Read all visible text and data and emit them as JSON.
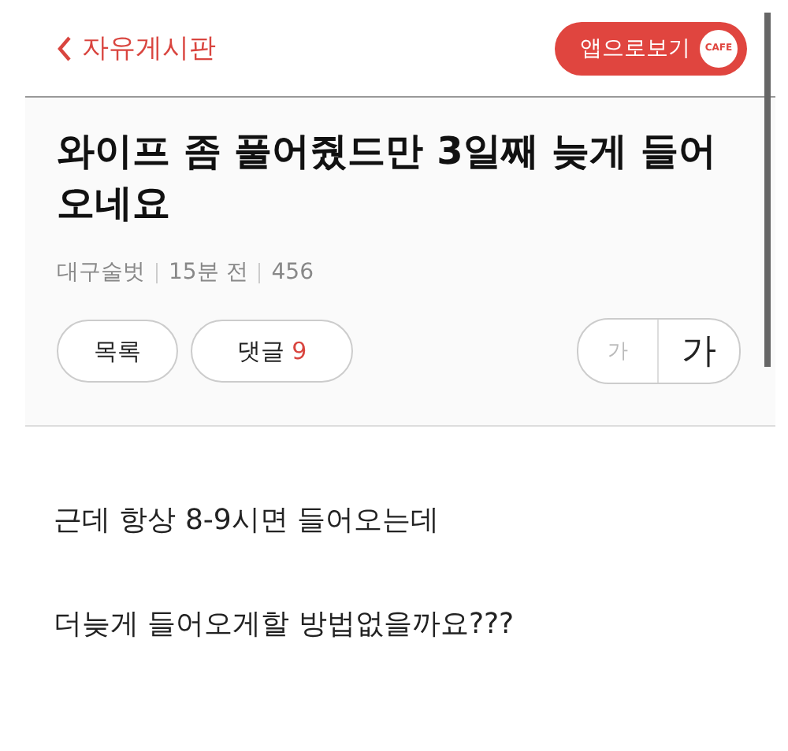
{
  "header": {
    "back_label": "자유게시판",
    "app_button": {
      "label": "앱으로보기",
      "badge": "CAFE"
    }
  },
  "post": {
    "title": "와이프 좀 풀어줬드만 3일째 늦게 들어오네요",
    "author": "대구술벗",
    "time": "15분 전",
    "views": "456"
  },
  "actions": {
    "list_button": "목록",
    "comments_label": "댓글",
    "comments_count": "9",
    "font_small": "가",
    "font_large": "가"
  },
  "body": [
    "근데 항상 8-9시면 들어오는데",
    "더늦게 들어오게할 방법없을까요???"
  ]
}
